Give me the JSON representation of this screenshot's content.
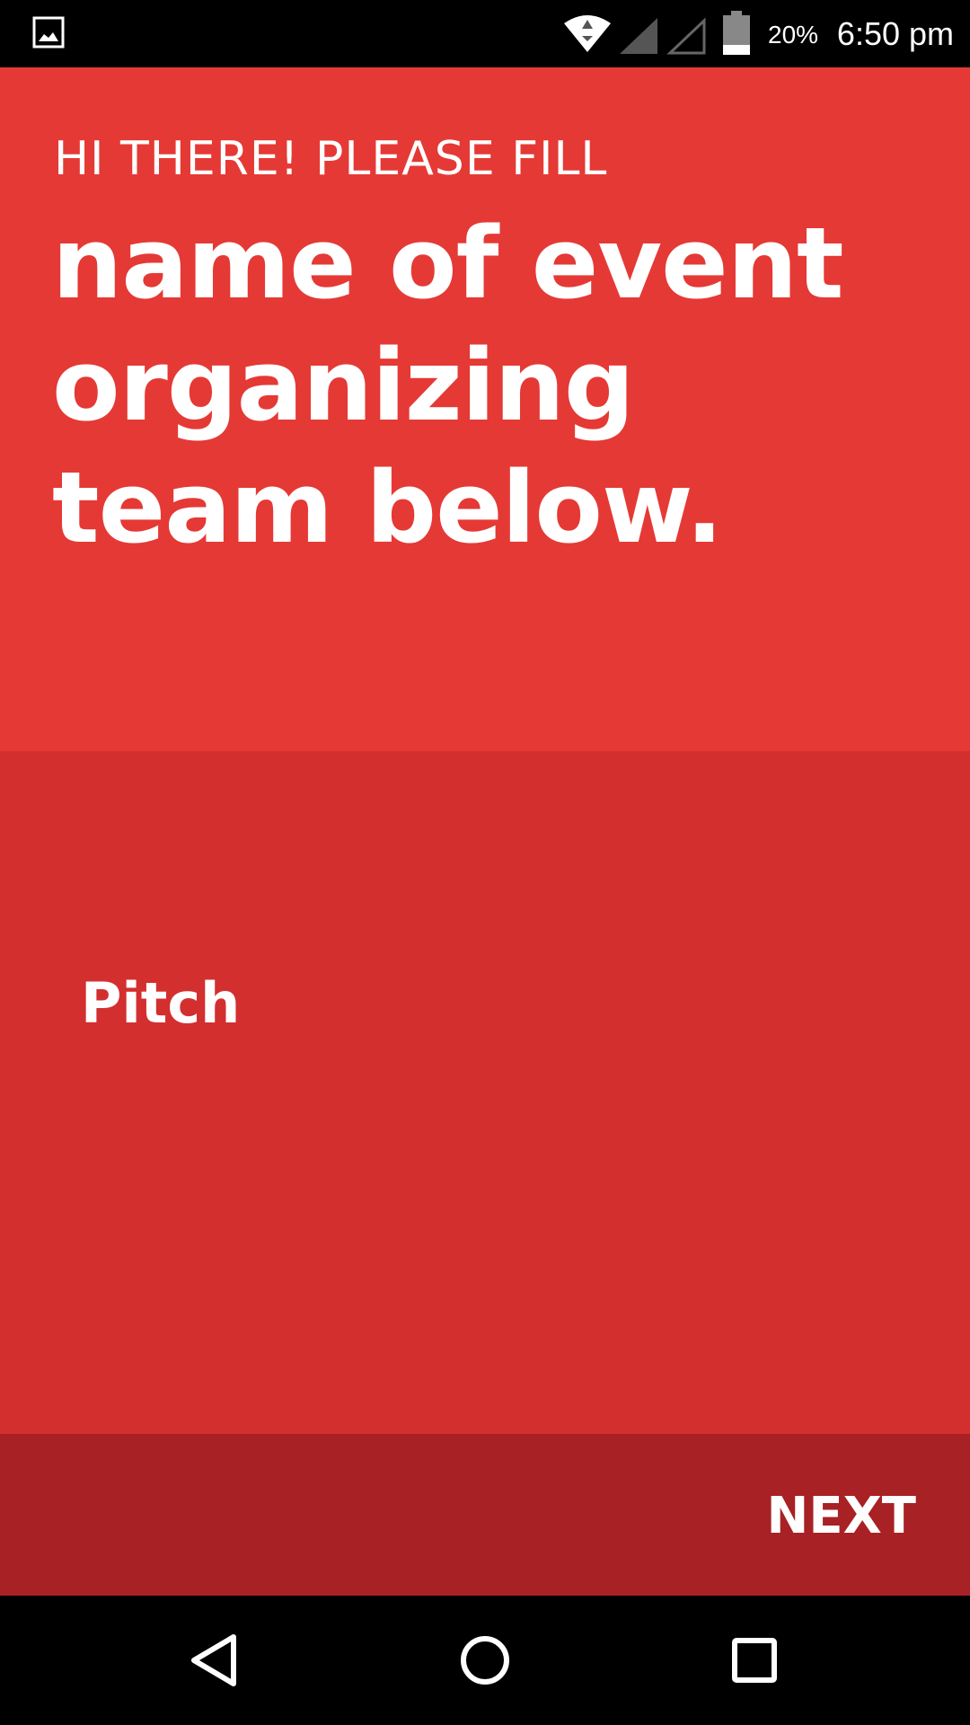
{
  "status_bar": {
    "battery_percent": "20%",
    "time": "6:50 pm",
    "icons": [
      "gallery-icon",
      "wifi-icon",
      "signal-icon",
      "signal-empty-icon",
      "battery-icon"
    ]
  },
  "question": {
    "prefix": "HI THERE! PLEASE FILL",
    "title": "name of event organizing team below."
  },
  "answer": {
    "value": "Pitch"
  },
  "actions": {
    "next_label": "NEXT"
  },
  "nav_bar": {
    "icons": [
      "back-icon",
      "home-icon",
      "recents-icon"
    ]
  },
  "colors": {
    "question_bg": "#e53935",
    "answer_bg": "#d32f2f",
    "action_bar_bg": "#a82124",
    "text": "#ffffff"
  }
}
